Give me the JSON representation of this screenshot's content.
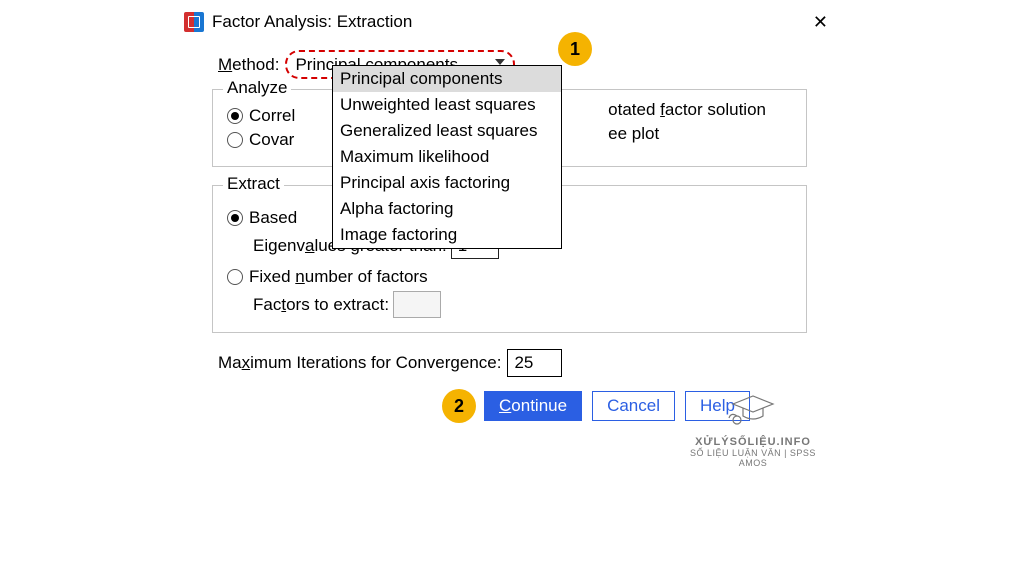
{
  "title": "Factor Analysis: Extraction",
  "method": {
    "label": "Method:",
    "selected": "Principal components",
    "options": [
      "Principal components",
      "Unweighted least squares",
      "Generalized least squares",
      "Maximum likelihood",
      "Principal axis factoring",
      "Alpha factoring",
      "Image factoring"
    ]
  },
  "badges": {
    "one": "1",
    "two": "2"
  },
  "groups": {
    "analyze": {
      "title": "Analyze",
      "correlation_label": "Correl",
      "covariance_label": "Covar",
      "correlation_selected": true
    },
    "display": {
      "unrotated_label_suffix": "otated factor solution",
      "scree_label_suffix": "ee plot"
    },
    "extract": {
      "title": "Extract",
      "eigen_radio_label": "Based",
      "eigen_field_label": "Eigenvalues greater than:",
      "eigen_value": "1",
      "fixed_radio_label": "Fixed number of factors",
      "fixed_field_label": "Factors to extract:",
      "fixed_value": ""
    }
  },
  "max_iter": {
    "label_pre": "Ma",
    "label_mid": "x",
    "label_post": "imum Iterations for Convergence:",
    "value": "25"
  },
  "buttons": {
    "continue": "Continue",
    "cancel": "Cancel",
    "help": "Help"
  },
  "watermark": {
    "brand": "XỬLÝSỐLIỆU.INFO",
    "tagline": "SỐ LIỆU LUẬN VĂN | SPSS AMOS"
  }
}
